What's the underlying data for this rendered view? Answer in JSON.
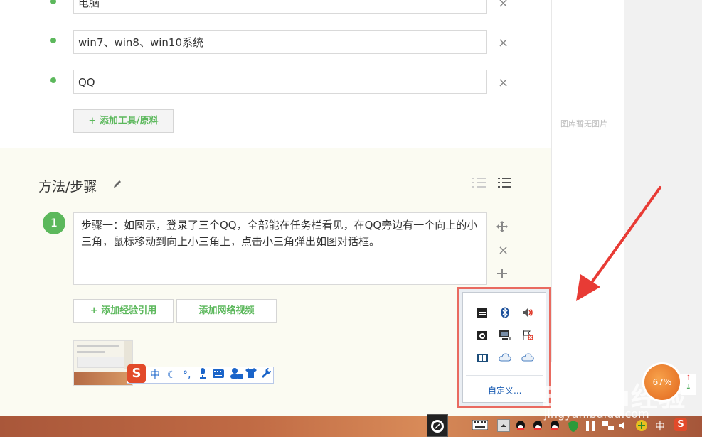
{
  "tools": {
    "items": [
      {
        "value": "电脑"
      },
      {
        "value": "win7、win8、win10系统"
      },
      {
        "value": "QQ"
      }
    ],
    "remove_symbol": "×",
    "add_button": "+ 添加工具/原料"
  },
  "method": {
    "title": "方法/步骤",
    "edit_icon": "pencil-icon",
    "step": {
      "number": "1",
      "text": "步骤一：如图示，登录了三个QQ，全部能在任务栏看见，在QQ旁边有一个向上的小三角，鼠标移动到向上小三角上，点击小三角弹出如图对话框。"
    },
    "add_reference_button": "+ 添加经验引用",
    "add_video_button": "添加网络视频"
  },
  "gallery": {
    "empty_text": "图库暂无图片"
  },
  "tray_popup": {
    "icons": [
      "keyboard-icon",
      "bluetooth-icon",
      "volume-icon",
      "camera-icon",
      "monitor-icon",
      "flag-icon",
      "app-icon",
      "cloud-icon",
      "cloud-icon"
    ],
    "customize_label": "自定义..."
  },
  "ime_toolbar": {
    "logo": "S",
    "lang": "中"
  },
  "speed_ball": {
    "value": "67%"
  },
  "watermark": {
    "brand": "Baidu经验",
    "url": "jingyan.baidu.com"
  },
  "taskbar": {
    "ime_lang": "中",
    "colors": {
      "accent": "#5cb85c",
      "highlight": "#e96a60"
    }
  }
}
